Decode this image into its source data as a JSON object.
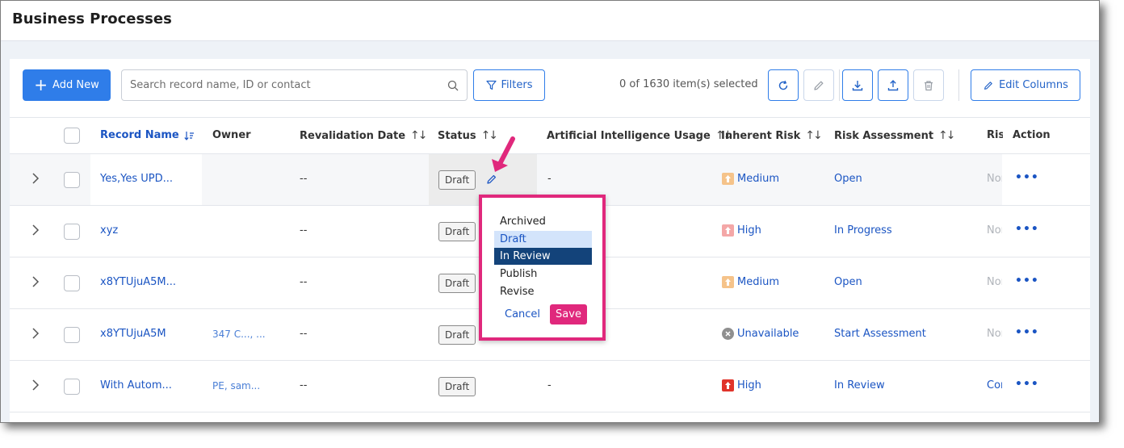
{
  "page": {
    "title": "Business Processes"
  },
  "toolbar": {
    "add_label": "Add New",
    "search_placeholder": "Search record name, ID or contact",
    "filters_label": "Filters",
    "selection_text": "0 of 1630 item(s) selected",
    "edit_columns_label": "Edit Columns",
    "icons": [
      "refresh-icon",
      "edit-icon",
      "download-icon",
      "upload-icon",
      "trash-icon"
    ]
  },
  "table": {
    "columns": [
      "Record Name",
      "Owner",
      "Revalidation Date",
      "Status",
      "Artificial Intelligence Usage",
      "Inherent Risk",
      "Risk Assessment",
      "Risi",
      "Action"
    ],
    "rows": [
      {
        "name": "Yes,Yes UPD...",
        "owner": "",
        "revalidation": "--",
        "status": "Draft",
        "ai_usage": "-",
        "inherent_risk": "Medium",
        "risk_level": "medium",
        "risk_assessment": "Open",
        "risi": "Nor"
      },
      {
        "name": "xyz",
        "owner": "",
        "revalidation": "--",
        "status": "Draft",
        "ai_usage": "",
        "inherent_risk": "High",
        "risk_level": "high-light",
        "risk_assessment": "In Progress",
        "risi": "Nor"
      },
      {
        "name": "x8YTUjuA5M...",
        "owner": "",
        "revalidation": "--",
        "status": "Draft",
        "ai_usage": "",
        "inherent_risk": "Medium",
        "risk_level": "medium",
        "risk_assessment": "Open",
        "risi": "Nor"
      },
      {
        "name": "x8YTUjuA5M",
        "owner": "347 C..., ...",
        "revalidation": "--",
        "status": "Draft",
        "ai_usage": "",
        "inherent_risk": "Unavailable",
        "risk_level": "unavailable",
        "risk_assessment": "Start Assessment",
        "risi": "Nor"
      },
      {
        "name": "With Autom...",
        "owner": "PE, sam...",
        "revalidation": "--",
        "status": "Draft",
        "ai_usage": "-",
        "inherent_risk": "High",
        "risk_level": "high",
        "risk_assessment": "In Review",
        "risi": "Cor"
      }
    ],
    "action_label": "•••"
  },
  "status_popover": {
    "options": [
      "Archived",
      "Draft",
      "In Review",
      "Publish",
      "Revise"
    ],
    "hovered": "Draft",
    "selected": "In Review",
    "cancel_label": "Cancel",
    "save_label": "Save"
  },
  "colors": {
    "primary": "#2f7de9",
    "link": "#1b55c3",
    "accent_pink": "#e0287c",
    "selected_option": "#13437a"
  }
}
